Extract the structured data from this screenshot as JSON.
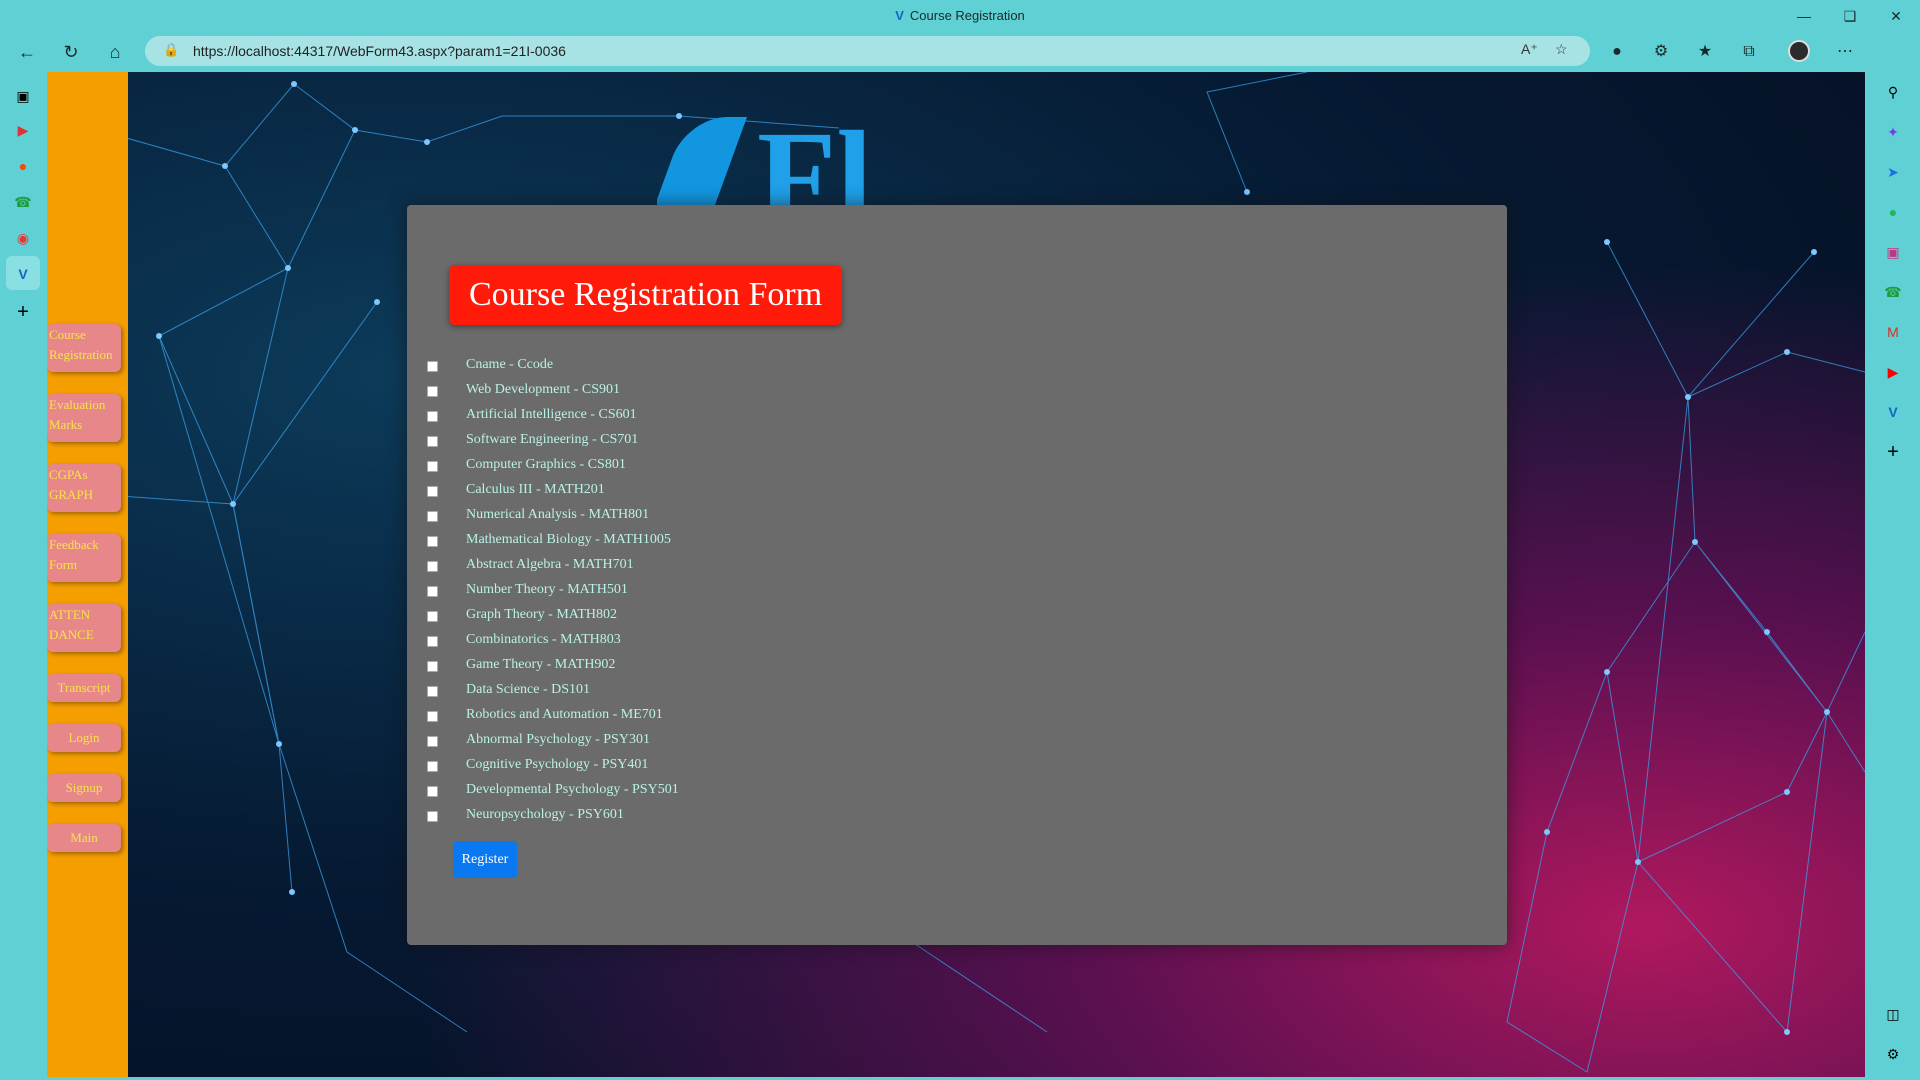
{
  "browser": {
    "window_title": "Course Registration",
    "url_prefix": "https://",
    "url_host": "localhost",
    "url_rest": ":44317/WebForm43.aspx?param1=21I-0036"
  },
  "sidebar": {
    "items": [
      {
        "label": "Course Registration"
      },
      {
        "label": "Evaluation Marks"
      },
      {
        "label": "CGPAs GRAPH"
      },
      {
        "label": "Feedback Form"
      },
      {
        "label": "ATTEN DANCE"
      },
      {
        "label": "Transcript"
      },
      {
        "label": "Login"
      },
      {
        "label": "Signup"
      },
      {
        "label": "Main"
      }
    ]
  },
  "form": {
    "title": "Course Registration Form",
    "courses": [
      {
        "label": "Cname - Ccode"
      },
      {
        "label": "Web Development - CS901"
      },
      {
        "label": "Artificial Intelligence - CS601"
      },
      {
        "label": "Software Engineering - CS701"
      },
      {
        "label": "Computer Graphics - CS801"
      },
      {
        "label": "Calculus III - MATH201"
      },
      {
        "label": "Numerical Analysis - MATH801"
      },
      {
        "label": "Mathematical Biology - MATH1005"
      },
      {
        "label": "Abstract Algebra - MATH701"
      },
      {
        "label": "Number Theory - MATH501"
      },
      {
        "label": "Graph Theory - MATH802"
      },
      {
        "label": "Combinatorics - MATH803"
      },
      {
        "label": "Game Theory - MATH902"
      },
      {
        "label": "Data Science - DS101"
      },
      {
        "label": "Robotics and Automation - ME701"
      },
      {
        "label": "Abnormal Psychology - PSY301"
      },
      {
        "label": "Cognitive Psychology - PSY401"
      },
      {
        "label": "Developmental Psychology - PSY501"
      },
      {
        "label": "Neuropsychology - PSY601"
      }
    ],
    "register_label": "Register"
  },
  "colors": {
    "accent_sidebar": "#f59e00",
    "nav_button": "#e8878a",
    "nav_text": "#f6e34a",
    "title_bg": "#ff1a0a",
    "register_bg": "#0a78f0",
    "panel_bg": "#6b6b6b"
  }
}
